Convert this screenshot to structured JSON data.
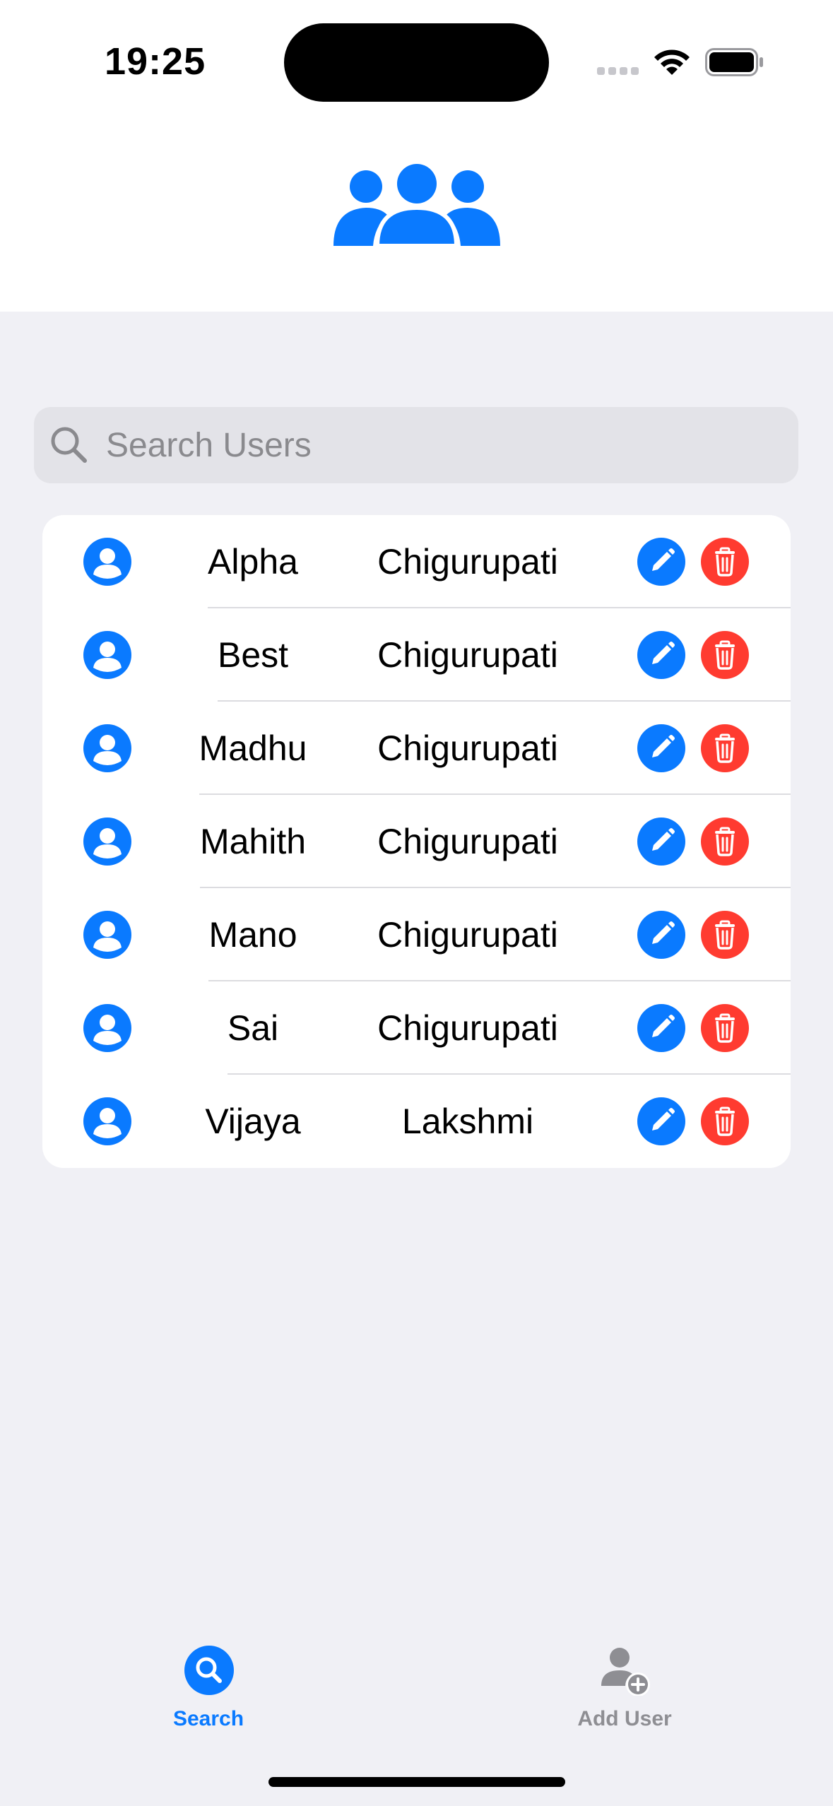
{
  "status_bar": {
    "time": "19:25"
  },
  "header": {
    "icon": "person-3-fill-icon",
    "accent_color": "#0A7AFF"
  },
  "search": {
    "placeholder": "Search Users",
    "value": ""
  },
  "users": [
    {
      "first_name": "Alpha",
      "last_name": "Chigurupati"
    },
    {
      "first_name": "Best",
      "last_name": "Chigurupati"
    },
    {
      "first_name": "Madhu",
      "last_name": "Chigurupati"
    },
    {
      "first_name": "Mahith",
      "last_name": "Chigurupati"
    },
    {
      "first_name": "Mano",
      "last_name": "Chigurupati"
    },
    {
      "first_name": "Sai",
      "last_name": "Chigurupati"
    },
    {
      "first_name": "Vijaya",
      "last_name": "Lakshmi"
    }
  ],
  "row_actions": {
    "edit_icon": "pencil-icon",
    "delete_icon": "trash-icon",
    "edit_color": "#0A7AFF",
    "delete_color": "#FF3B30"
  },
  "tab_bar": {
    "tabs": [
      {
        "label": "Search",
        "icon": "magnifyingglass-circle-fill-icon",
        "selected": true
      },
      {
        "label": "Add User",
        "icon": "person-badge-plus-icon",
        "selected": false
      }
    ]
  }
}
